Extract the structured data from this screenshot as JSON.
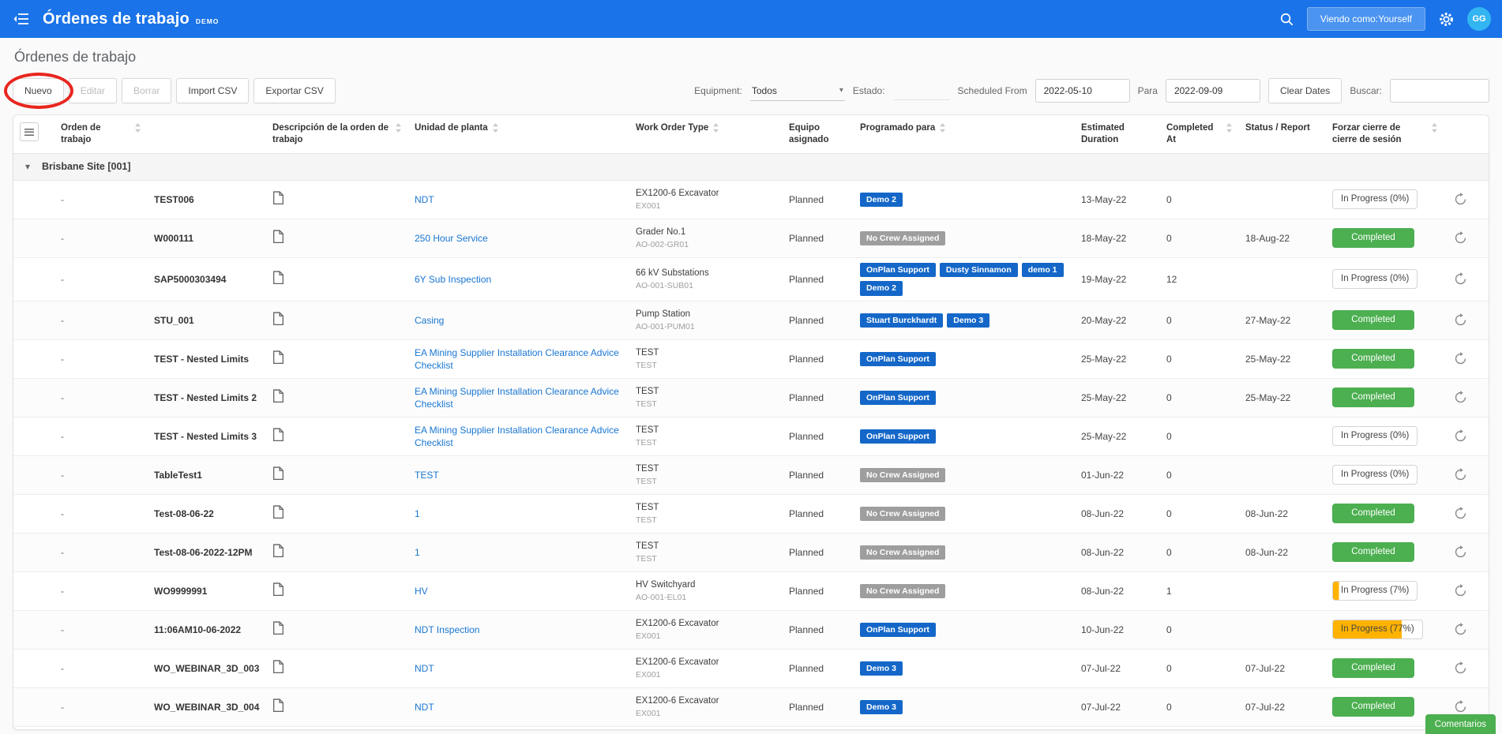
{
  "colors": {
    "header_blue": "#1a73e8",
    "viewing_button_blue": "#4b94f0",
    "avatar_cyan": "#33b5f2",
    "link_blue": "#1976d2",
    "badge_blue": "#1467c8",
    "badge_gray": "#9e9e9e",
    "completed_green": "#4caf50",
    "progress_orange": "#ffb300",
    "annotation_red": "#e8261f"
  },
  "app_bar": {
    "title": "Órdenes de trabajo",
    "demo_tag": "DEMO",
    "viewing_as_button": "Viendo como:Yourself",
    "avatar_initials": "GG"
  },
  "page": {
    "title": "Órdenes de trabajo"
  },
  "toolbar": {
    "buttons": [
      {
        "label": "Nuevo",
        "enabled": true
      },
      {
        "label": "Editar",
        "enabled": false
      },
      {
        "label": "Borrar",
        "enabled": false
      },
      {
        "label": "Import CSV",
        "enabled": true
      },
      {
        "label": "Exportar CSV",
        "enabled": true
      }
    ]
  },
  "filters": {
    "equipment_label": "Equipment:",
    "equipment_value": "Todos",
    "estado_label": "Estado:",
    "scheduled_from_label": "Scheduled From",
    "scheduled_from_value": "2022-05-10",
    "para_label": "Para",
    "para_value": "2022-09-09",
    "clear_dates_button": "Clear Dates",
    "buscar_label": "Buscar:",
    "buscar_value": ""
  },
  "table": {
    "columns": [
      {
        "key": "handle",
        "label": "",
        "sortable": false
      },
      {
        "key": "orden",
        "label": "Orden de trabajo",
        "sortable": true
      },
      {
        "key": "name",
        "label": "",
        "sortable": false
      },
      {
        "key": "desc",
        "label": "Descripción de la orden de trabajo",
        "sortable": true
      },
      {
        "key": "unidad",
        "label": "Unidad de planta",
        "sortable": true
      },
      {
        "key": "wo_type",
        "label": "Work Order Type",
        "sortable": true
      },
      {
        "key": "equipo",
        "label": "Equipo asignado",
        "sortable": false
      },
      {
        "key": "programado",
        "label": "Programado para",
        "sortable": true
      },
      {
        "key": "duration",
        "label": "Estimated Duration",
        "sortable": false
      },
      {
        "key": "completed",
        "label": "Completed At",
        "sortable": true
      },
      {
        "key": "report",
        "label": "Status / Report",
        "sortable": false
      },
      {
        "key": "forzar",
        "label": "Forzar cierre de cierre de sesión",
        "sortable": true
      },
      {
        "key": "action",
        "label": "",
        "sortable": false
      }
    ],
    "group": {
      "label": "Brisbane Site [001]"
    },
    "rows": [
      {
        "orden": "-",
        "name": "TEST006",
        "unidad": "NDT",
        "wo_type": "EX1200-6 Excavator",
        "wo_type_sub": "EX001",
        "equipo": "Planned",
        "crews": [
          {
            "label": "Demo 2",
            "variant": "blue"
          }
        ],
        "duration": "13-May-22",
        "completed_at": "0",
        "report_date": "",
        "status": {
          "label": "In Progress (0%)",
          "kind": "progress",
          "pct": 0
        }
      },
      {
        "orden": "-",
        "name": "W000111",
        "unidad": "250 Hour Service",
        "wo_type": "Grader No.1",
        "wo_type_sub": "AO-002-GR01",
        "equipo": "Planned",
        "crews": [
          {
            "label": "No Crew Assigned",
            "variant": "gray"
          }
        ],
        "duration": "18-May-22",
        "completed_at": "0",
        "report_date": "18-Aug-22",
        "status": {
          "label": "Completed",
          "kind": "completed",
          "pct": 100
        }
      },
      {
        "orden": "-",
        "name": "SAP5000303494",
        "unidad": "6Y Sub Inspection",
        "wo_type": "66 kV Substations",
        "wo_type_sub": "AO-001-SUB01",
        "equipo": "Planned",
        "crews": [
          {
            "label": "OnPlan Support",
            "variant": "blue"
          },
          {
            "label": "Dusty Sinnamon",
            "variant": "blue"
          },
          {
            "label": "demo 1",
            "variant": "blue"
          },
          {
            "label": "Demo 2",
            "variant": "blue"
          }
        ],
        "duration": "19-May-22",
        "completed_at": "12",
        "report_date": "",
        "status": {
          "label": "In Progress (0%)",
          "kind": "progress",
          "pct": 0
        }
      },
      {
        "orden": "-",
        "name": "STU_001",
        "unidad": "Casing",
        "wo_type": "Pump Station",
        "wo_type_sub": "AO-001-PUM01",
        "equipo": "Planned",
        "crews": [
          {
            "label": "Stuart Burckhardt",
            "variant": "blue"
          },
          {
            "label": "Demo 3",
            "variant": "blue"
          }
        ],
        "duration": "20-May-22",
        "completed_at": "0",
        "report_date": "27-May-22",
        "status": {
          "label": "Completed",
          "kind": "completed",
          "pct": 100
        }
      },
      {
        "orden": "-",
        "name": "TEST - Nested Limits",
        "unidad": "EA Mining Supplier Installation Clearance Advice Checklist",
        "wo_type": "TEST",
        "wo_type_sub": "TEST",
        "equipo": "Planned",
        "crews": [
          {
            "label": "OnPlan Support",
            "variant": "blue"
          }
        ],
        "duration": "25-May-22",
        "completed_at": "0",
        "report_date": "25-May-22",
        "status": {
          "label": "Completed",
          "kind": "completed",
          "pct": 100
        }
      },
      {
        "orden": "-",
        "name": "TEST - Nested Limits 2",
        "unidad": "EA Mining Supplier Installation Clearance Advice Checklist",
        "wo_type": "TEST",
        "wo_type_sub": "TEST",
        "equipo": "Planned",
        "crews": [
          {
            "label": "OnPlan Support",
            "variant": "blue"
          }
        ],
        "duration": "25-May-22",
        "completed_at": "0",
        "report_date": "25-May-22",
        "status": {
          "label": "Completed",
          "kind": "completed",
          "pct": 100
        }
      },
      {
        "orden": "-",
        "name": "TEST - Nested Limits 3",
        "unidad": "EA Mining Supplier Installation Clearance Advice Checklist",
        "wo_type": "TEST",
        "wo_type_sub": "TEST",
        "equipo": "Planned",
        "crews": [
          {
            "label": "OnPlan Support",
            "variant": "blue"
          }
        ],
        "duration": "25-May-22",
        "completed_at": "0",
        "report_date": "",
        "status": {
          "label": "In Progress (0%)",
          "kind": "progress",
          "pct": 0
        }
      },
      {
        "orden": "-",
        "name": "TableTest1",
        "unidad": "TEST",
        "wo_type": "TEST",
        "wo_type_sub": "TEST",
        "equipo": "Planned",
        "crews": [
          {
            "label": "No Crew Assigned",
            "variant": "gray"
          }
        ],
        "duration": "01-Jun-22",
        "completed_at": "0",
        "report_date": "",
        "status": {
          "label": "In Progress (0%)",
          "kind": "progress",
          "pct": 0
        }
      },
      {
        "orden": "-",
        "name": "Test-08-06-22",
        "unidad": "1",
        "wo_type": "TEST",
        "wo_type_sub": "TEST",
        "equipo": "Planned",
        "crews": [
          {
            "label": "No Crew Assigned",
            "variant": "gray"
          }
        ],
        "duration": "08-Jun-22",
        "completed_at": "0",
        "report_date": "08-Jun-22",
        "status": {
          "label": "Completed",
          "kind": "completed",
          "pct": 100
        }
      },
      {
        "orden": "-",
        "name": "Test-08-06-2022-12PM",
        "unidad": "1",
        "wo_type": "TEST",
        "wo_type_sub": "TEST",
        "equipo": "Planned",
        "crews": [
          {
            "label": "No Crew Assigned",
            "variant": "gray"
          }
        ],
        "duration": "08-Jun-22",
        "completed_at": "0",
        "report_date": "08-Jun-22",
        "status": {
          "label": "Completed",
          "kind": "completed",
          "pct": 100
        }
      },
      {
        "orden": "-",
        "name": "WO9999991",
        "unidad": "HV",
        "wo_type": "HV Switchyard",
        "wo_type_sub": "AO-001-EL01",
        "equipo": "Planned",
        "crews": [
          {
            "label": "No Crew Assigned",
            "variant": "gray"
          }
        ],
        "duration": "08-Jun-22",
        "completed_at": "1",
        "report_date": "",
        "status": {
          "label": "In Progress (7%)",
          "kind": "progress",
          "pct": 7
        }
      },
      {
        "orden": "-",
        "name": "11:06AM10-06-2022",
        "unidad": "NDT Inspection",
        "wo_type": "EX1200-6 Excavator",
        "wo_type_sub": "EX001",
        "equipo": "Planned",
        "crews": [
          {
            "label": "OnPlan Support",
            "variant": "blue"
          }
        ],
        "duration": "10-Jun-22",
        "completed_at": "0",
        "report_date": "",
        "status": {
          "label": "In Progress (77%)",
          "kind": "progress",
          "pct": 77
        }
      },
      {
        "orden": "-",
        "name": "WO_WEBINAR_3D_003",
        "unidad": "NDT",
        "wo_type": "EX1200-6 Excavator",
        "wo_type_sub": "EX001",
        "equipo": "Planned",
        "crews": [
          {
            "label": "Demo 3",
            "variant": "blue"
          }
        ],
        "duration": "07-Jul-22",
        "completed_at": "0",
        "report_date": "07-Jul-22",
        "status": {
          "label": "Completed",
          "kind": "completed",
          "pct": 100
        }
      },
      {
        "orden": "-",
        "name": "WO_WEBINAR_3D_004",
        "unidad": "NDT",
        "wo_type": "EX1200-6 Excavator",
        "wo_type_sub": "EX001",
        "equipo": "Planned",
        "crews": [
          {
            "label": "Demo 3",
            "variant": "blue"
          }
        ],
        "duration": "07-Jul-22",
        "completed_at": "0",
        "report_date": "07-Jul-22",
        "status": {
          "label": "Completed",
          "kind": "completed",
          "pct": 100
        }
      }
    ]
  },
  "comments_button": "Comentarios"
}
